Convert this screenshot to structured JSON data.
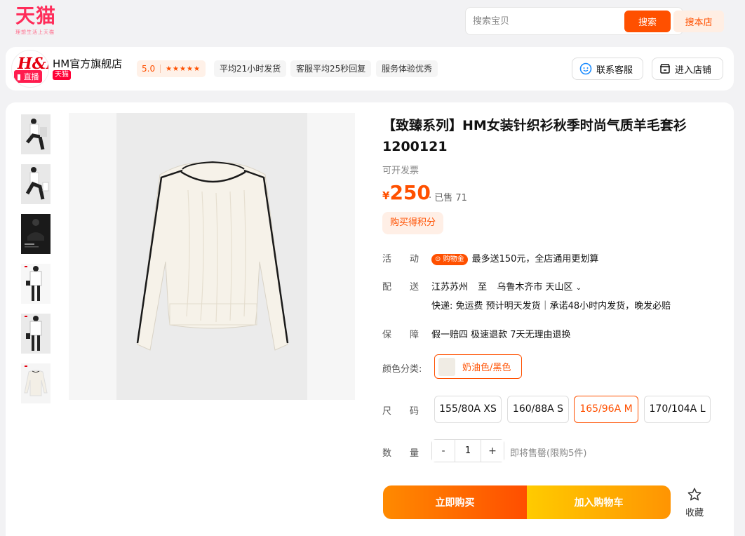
{
  "brand": {
    "logo_text": "天猫",
    "logo_sub": "理想生活上天猫"
  },
  "search": {
    "placeholder": "搜索宝贝",
    "search_label": "搜索",
    "store_search_label": "搜本店"
  },
  "store": {
    "avatar_text": "H&M",
    "live_label": "直播",
    "name": "HM官方旗舰店",
    "tmall_tag": "天猫",
    "rating": "5.0",
    "stars": "★★★★★",
    "tags": [
      "平均21小时发货",
      "客服平均25秒回复",
      "服务体验优秀"
    ],
    "contact_label": "联系客服",
    "enter_store_label": "进入店铺"
  },
  "product": {
    "title": "【致臻系列】HM女装针织衫秋季时尚气质羊毛套衫1200121",
    "invoice": "可开发票",
    "currency": "¥",
    "price": "250",
    "sold": "· 已售 71",
    "points_tag": "购买得积分",
    "promo": {
      "label": "活动:",
      "coupon": "购物金",
      "text": "最多送150元，全店通用更划算"
    },
    "delivery": {
      "label": "配送:",
      "from": "江苏苏州",
      "to_word": "至",
      "to": "乌鲁木齐市 天山区",
      "detail": "快递: 免运费   预计明天发货｜承诺48小时内发货，晚发必赔"
    },
    "guarantee": {
      "label": "保障:",
      "text": "假一赔四 极速退款 7天无理由退换"
    },
    "color": {
      "label": "颜色分类:",
      "selected": "奶油色/黑色"
    },
    "size": {
      "label": "尺码:",
      "options": [
        "155/80A XS",
        "160/88A S",
        "165/96A M",
        "170/104A L"
      ],
      "selected": "165/96A M"
    },
    "quantity": {
      "label": "数量:",
      "minus": "-",
      "value": "1",
      "plus": "+",
      "hint": "即将售罄(限购5件)"
    },
    "buy_now_label": "立即购买",
    "add_cart_label": "加入购物车",
    "favorite_label": "收藏"
  },
  "colors": {
    "accent": "#ff5000",
    "brand": "#ff2d5a"
  }
}
